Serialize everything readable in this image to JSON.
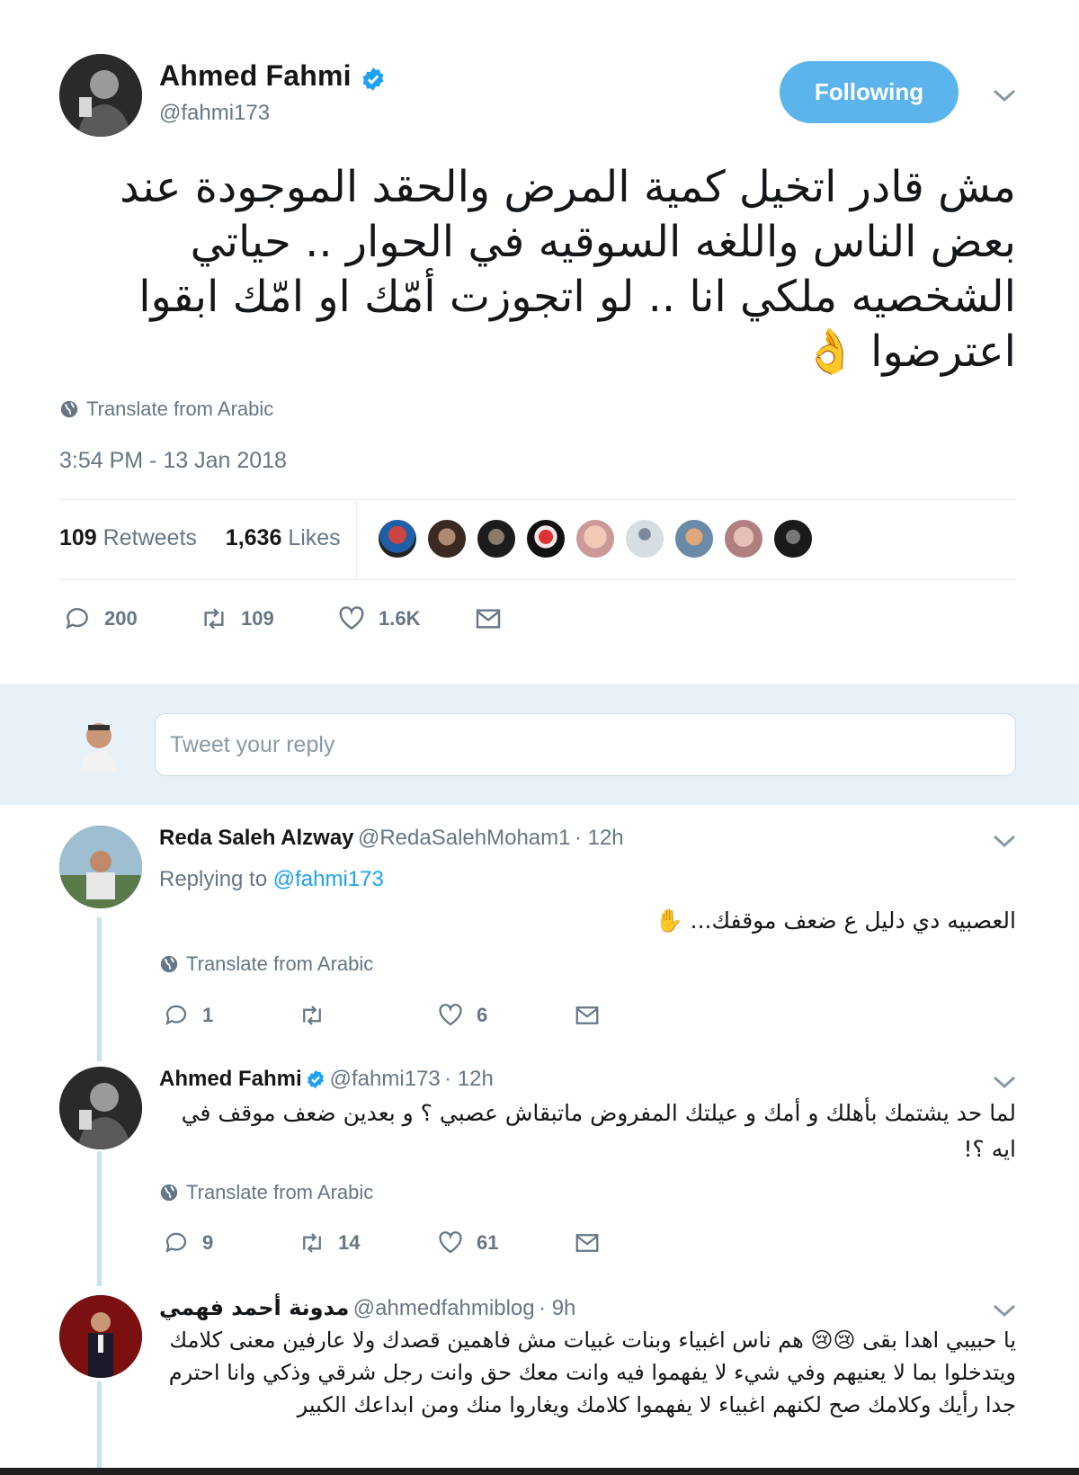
{
  "tweet": {
    "author_name": "Ahmed Fahmi",
    "author_handle": "@fahmi173",
    "follow_label": "Following",
    "text": "مش قادر اتخيل كمية المرض والحقد الموجودة عند بعض الناس واللغه السوقيه في الحوار .. حياتي الشخصيه ملكي انا .. لو اتجوزت أمّك او امّك ابقوا اعترضوا 👌",
    "translate_label": "Translate from Arabic",
    "timestamp": "3:54 PM - 13 Jan 2018",
    "retweets_count": "109",
    "retweets_label": "Retweets",
    "likes_count": "1,636",
    "likes_label": "Likes",
    "actions": {
      "reply": "200",
      "retweet": "109",
      "like": "1.6K"
    }
  },
  "composer": {
    "placeholder": "Tweet your reply"
  },
  "replies": [
    {
      "name": "Reda Saleh Alzway",
      "handle": "@RedaSalehMoham1",
      "time": "· 12h",
      "replying_label": "Replying to",
      "replying_to": "@fahmi173",
      "text": "العصبيه دي دليل ع ضعف موقفك... ✋",
      "translate_label": "Translate from Arabic",
      "actions": {
        "reply": "1",
        "retweet": "",
        "like": "6"
      }
    },
    {
      "name": "Ahmed Fahmi",
      "handle": "@fahmi173",
      "time": "· 12h",
      "text": "لما حد يشتمك بأهلك و أمك و عيلتك المفروض ماتبقاش عصبي ؟ و بعدين ضعف موقف في ايه ؟!",
      "translate_label": "Translate from Arabic",
      "actions": {
        "reply": "9",
        "retweet": "14",
        "like": "61"
      }
    },
    {
      "name": "مدونة أحمد فهمي",
      "handle": "@ahmedfahmiblog",
      "time": "· 9h",
      "text": "يا حبيبي اهدا بقى 😢😢 هم ناس اغبياء وبنات غبيات مش فاهمين قصدك ولا عارفين معنى كلامك ويتدخلوا بما لا يعنيهم وفي شيء لا يفهموا فيه وانت معك حق وانت رجل شرقي وذكي وانا احترم جدا رأيك وكلامك صح لكنهم اغبياء لا يفهموا كلامك ويغاروا منك ومن ابداعك الكبير"
    }
  ],
  "colors": {
    "accent": "#1da1f2",
    "follow_button": "#5bb4ec",
    "muted": "#657786",
    "thread_line": "#c5e2f7",
    "reply_band": "#e9f1f8"
  },
  "icons": [
    "verified-icon",
    "chevron-down-icon",
    "globe-icon",
    "reply-icon",
    "retweet-icon",
    "like-icon",
    "message-icon"
  ]
}
